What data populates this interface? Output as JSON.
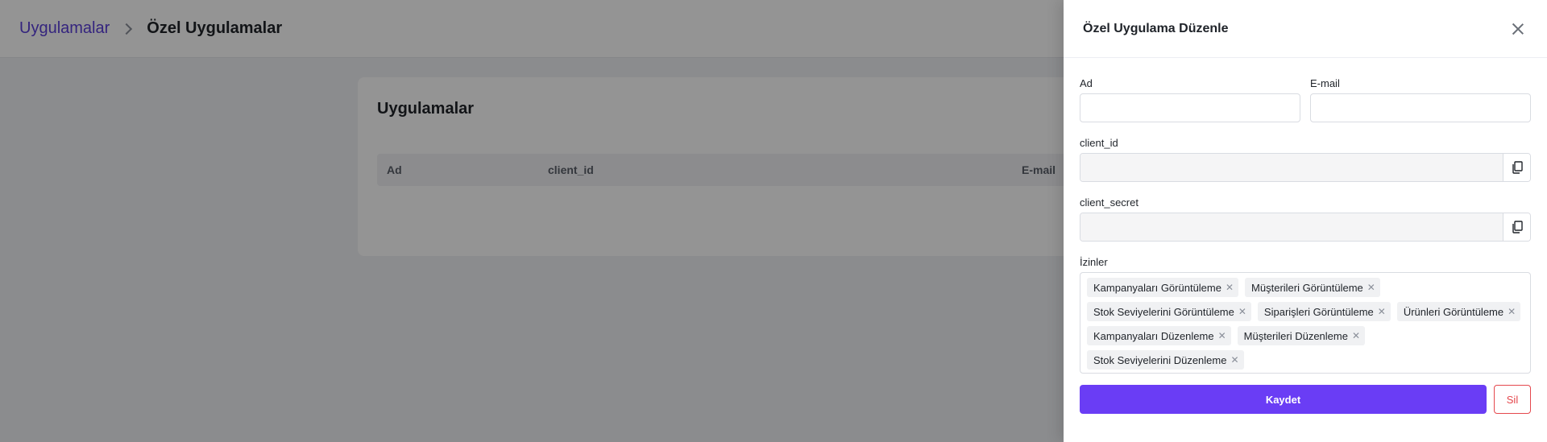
{
  "breadcrumb": {
    "parent": "Uygulamalar",
    "current": "Özel Uygulamalar"
  },
  "card": {
    "title": "Uygulamalar",
    "columns": [
      "Ad",
      "client_id",
      "E-mail"
    ]
  },
  "drawer": {
    "title": "Özel Uygulama Düzenle",
    "fields": {
      "name_label": "Ad",
      "name_value": "",
      "email_label": "E-mail",
      "email_value": "",
      "client_id_label": "client_id",
      "client_id_value": "",
      "client_secret_label": "client_secret",
      "client_secret_value": ""
    },
    "permissions_label": "İzinler",
    "permissions": [
      "Kampanyaları Görüntüleme",
      "Müşterileri Görüntüleme",
      "Stok Seviyelerini Görüntüleme",
      "Siparişleri Görüntüleme",
      "Ürünleri Görüntüleme",
      "Kampanyaları Düzenleme",
      "Müşterileri Düzenleme",
      "Stok Seviyelerini Düzenleme"
    ],
    "save_label": "Kaydet",
    "delete_label": "Sil"
  },
  "colors": {
    "accent": "#6a3df5",
    "danger": "#e5484d",
    "link": "#5b3fd9"
  }
}
